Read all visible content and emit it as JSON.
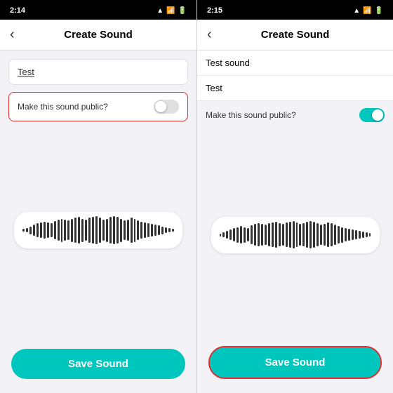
{
  "phone1": {
    "status": {
      "time": "2:14",
      "wifi": "▲",
      "battery": "▊"
    },
    "nav": {
      "back_label": "‹",
      "title": "Create Sound"
    },
    "form": {
      "name_value": "Test",
      "toggle_label": "Make this sound public?",
      "toggle_state": "off"
    },
    "waveform": {
      "bars": [
        3,
        6,
        10,
        14,
        18,
        20,
        22,
        20,
        18,
        24,
        28,
        30,
        28,
        26,
        30,
        32,
        34,
        30,
        28,
        32,
        34,
        36,
        32,
        28,
        30,
        34,
        36,
        34,
        30,
        26,
        28,
        32,
        30,
        26,
        22,
        20,
        18,
        16,
        14,
        12,
        10,
        8,
        6,
        4
      ]
    },
    "save_button": {
      "label": "Save Sound"
    }
  },
  "phone2": {
    "status": {
      "time": "2:15",
      "wifi": "▲",
      "battery": "▊"
    },
    "nav": {
      "back_label": "‹",
      "title": "Create Sound"
    },
    "form": {
      "name_value": "Test sound",
      "name2_value": "Test",
      "toggle_label": "Make this sound public?",
      "toggle_state": "on"
    },
    "waveform": {
      "bars": [
        3,
        6,
        10,
        14,
        18,
        20,
        22,
        20,
        18,
        24,
        28,
        30,
        28,
        26,
        30,
        32,
        34,
        30,
        28,
        32,
        34,
        36,
        32,
        28,
        30,
        34,
        36,
        34,
        30,
        26,
        28,
        32,
        30,
        26,
        22,
        20,
        18,
        16,
        14,
        12,
        10,
        8,
        6,
        4
      ]
    },
    "save_button": {
      "label": "Save Sound"
    }
  }
}
